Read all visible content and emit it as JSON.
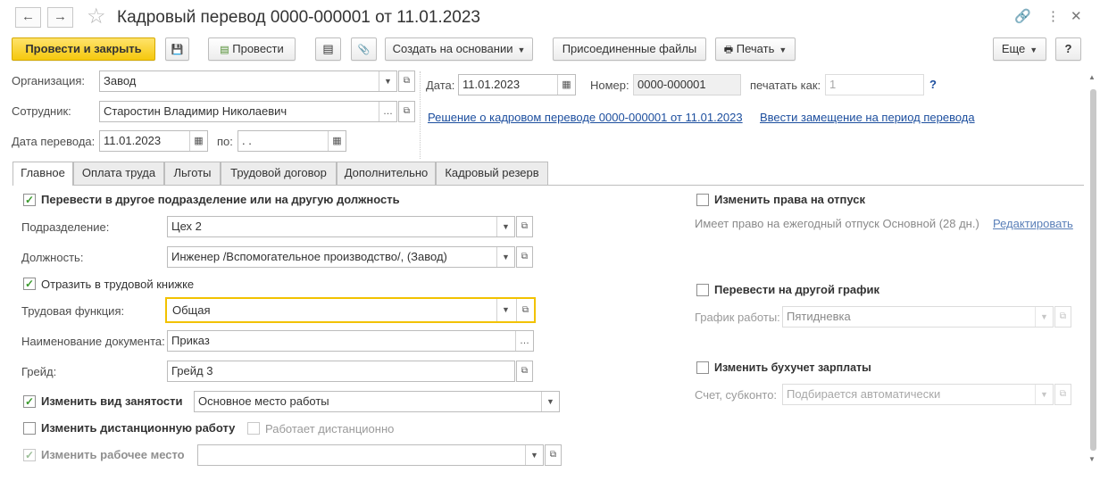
{
  "title": "Кадровый перевод 0000-000001 от 11.01.2023",
  "nav": {
    "back": "←",
    "forward": "→"
  },
  "title_icons": {
    "link": "🔗",
    "more": "⋮",
    "close": "✕"
  },
  "toolbar": {
    "post_close": "Провести и закрыть",
    "save_icon": "💾",
    "post": "Провести",
    "list_icon": "▤",
    "clip_icon": "📎",
    "create_based": "Создать на основании",
    "attached_files": "Присоединенные файлы",
    "print": "Печать",
    "more": "Еще",
    "help": "?"
  },
  "header": {
    "org_label": "Организация:",
    "org_value": "Завод",
    "emp_label": "Сотрудник:",
    "emp_value": "Старостин Владимир Николаевич",
    "date_transfer_label": "Дата перевода:",
    "date_transfer_value": "11.01.2023",
    "to_label": "по:",
    "to_value": " .  .",
    "date_label": "Дата:",
    "date_value": "11.01.2023",
    "number_label": "Номер:",
    "number_value": "0000-000001",
    "print_as_label": "печатать как:",
    "print_as_value": "1",
    "help_q": "?",
    "decision_link": "Решение о кадровом переводе 0000-000001 от 11.01.2023",
    "substitute_link": "Ввести замещение на период перевода"
  },
  "tabs": [
    "Главное",
    "Оплата труда",
    "Льготы",
    "Трудовой договор",
    "Дополнительно",
    "Кадровый резерв"
  ],
  "main": {
    "transfer_check": "Перевести в другое подразделение или на другую должность",
    "dept_label": "Подразделение:",
    "dept_value": "Цех 2",
    "pos_label": "Должность:",
    "pos_value": "Инженер /Вспомогательное производство/, (Завод)",
    "workbook_check": "Отразить в трудовой книжке",
    "func_label": "Трудовая функция:",
    "func_value": "Общая",
    "docname_label": "Наименование документа:",
    "docname_value": "Приказ",
    "grade_label": "Грейд:",
    "grade_value": "Грейд 3",
    "employment_check": "Изменить вид занятости",
    "employment_value": "Основное место работы",
    "remote_check": "Изменить дистанционную работу",
    "remote_sub": "Работает дистанционно",
    "workplace_check": "Изменить рабочее место",
    "workplace_value": ""
  },
  "right": {
    "vacation_check": "Изменить права на отпуск",
    "vacation_text": "Имеет право на ежегодный отпуск Основной (28 дн.)",
    "edit_link": "Редактировать",
    "schedule_check": "Перевести на другой график",
    "schedule_label": "График работы:",
    "schedule_value": "Пятидневка",
    "accounting_check": "Изменить бухучет зарплаты",
    "account_label": "Счет, субконто:",
    "account_value": "Подбирается автоматически"
  },
  "colors": {
    "primary": "#f5c80d",
    "link": "#1c4e9e",
    "check": "#3a9a2c",
    "focus": "#f2c200"
  }
}
